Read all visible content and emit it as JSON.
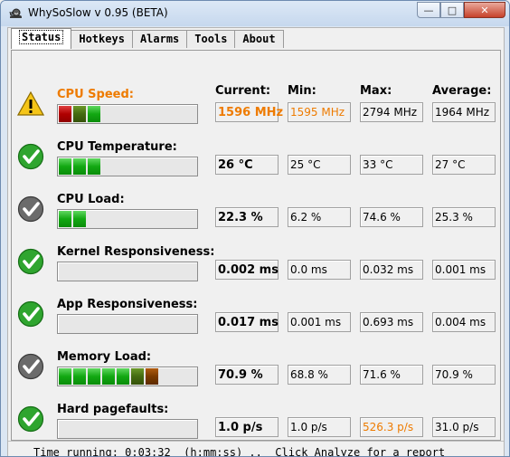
{
  "window": {
    "title": "WhySoSlow v 0.95  (BETA)"
  },
  "tabs": [
    {
      "label": "Status",
      "active": true
    },
    {
      "label": "Hotkeys",
      "active": false
    },
    {
      "label": "Alarms",
      "active": false
    },
    {
      "label": "Tools",
      "active": false
    },
    {
      "label": "About",
      "active": false
    }
  ],
  "headers": {
    "current": "Current:",
    "min": "Min:",
    "max": "Max:",
    "average": "Average:"
  },
  "metrics": [
    {
      "label": "CPU Speed:",
      "status": "warning",
      "current": "1596 MHz",
      "min": "1595 MHz",
      "max": "2794 MHz",
      "average": "1964 MHz"
    },
    {
      "label": "CPU Temperature:",
      "status": "ok",
      "current": "26 °C",
      "min": "25 °C",
      "max": "33 °C",
      "average": "27 °C"
    },
    {
      "label": "CPU Load:",
      "status": "ok-gray",
      "current": "22.3 %",
      "min": "6.2 %",
      "max": "74.6 %",
      "average": "25.3 %"
    },
    {
      "label": "Kernel Responsiveness:",
      "status": "ok",
      "current": "0.002 ms",
      "min": "0.0 ms",
      "max": "0.032 ms",
      "average": "0.001 ms"
    },
    {
      "label": "App Responsiveness:",
      "status": "ok",
      "current": "0.017 ms",
      "min": "0.001 ms",
      "max": "0.693 ms",
      "average": "0.004 ms"
    },
    {
      "label": "Memory Load:",
      "status": "ok-gray",
      "current": "70.9 %",
      "min": "68.8 %",
      "max": "71.6 %",
      "average": "70.9 %"
    },
    {
      "label": "Hard pagefaults:",
      "status": "ok",
      "current": "1.0 p/s",
      "min": "1.0 p/s",
      "max": "526.3 p/s",
      "average": "31.0 p/s"
    }
  ],
  "bars": [
    [
      "r",
      "dg",
      "g"
    ],
    [
      "g",
      "g",
      "g"
    ],
    [
      "g",
      "g"
    ],
    [],
    [],
    [
      "g",
      "g",
      "g",
      "g",
      "g",
      "dg",
      "br"
    ],
    []
  ],
  "status_bar": {
    "text": "Time running: 0:03:32  (h:mm:ss) ..  Click Analyze for a report"
  },
  "colors": {
    "accent_warning": "#ee7b00",
    "bar_green": "#12a812"
  }
}
